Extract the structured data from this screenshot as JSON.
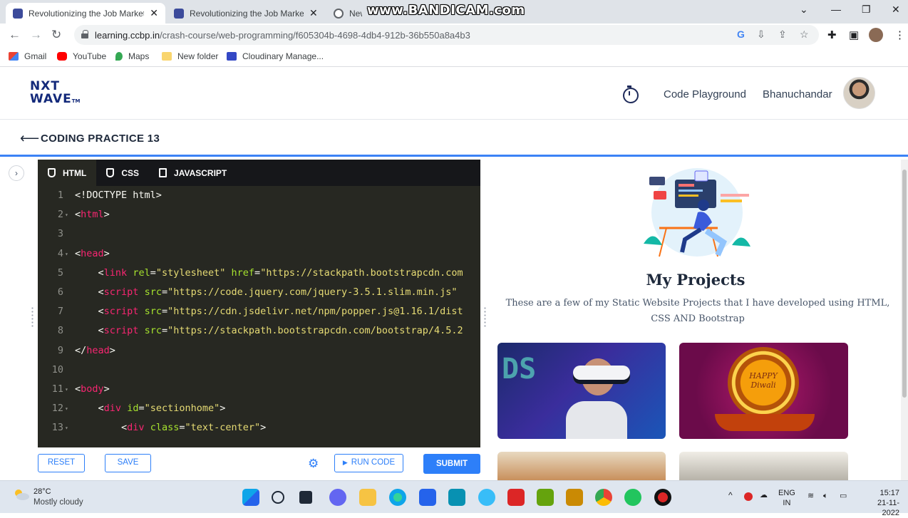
{
  "browser": {
    "tabs": [
      {
        "title": "Revolutionizing the Job Market |",
        "active": true
      },
      {
        "title": "Revolutionizing the Job Market |",
        "active": false
      },
      {
        "title": "New Tab",
        "active": false
      }
    ],
    "watermark": "www.BANDICAM.com",
    "url_host": "learning.ccbp.in",
    "url_path": "/crash-course/web-programming/f605304b-4698-4db4-912b-36b550a8a4b3",
    "bookmarks": [
      "Gmail",
      "YouTube",
      "Maps",
      "New folder",
      "Cloudinary Manage..."
    ]
  },
  "header": {
    "logo_line1": "NXT",
    "logo_line2": "WAVE",
    "logo_tm": "TM",
    "code_playground": "Code Playground",
    "username": "Bhanuchandar"
  },
  "practice": {
    "title": "CODING PRACTICE 13"
  },
  "editor": {
    "tabs": [
      "HTML",
      "CSS",
      "JAVASCRIPT"
    ],
    "active_tab": "HTML",
    "lines": [
      {
        "n": "1",
        "fold": "",
        "indent": "",
        "parts": [
          [
            "t",
            "<!DOCTYPE html>"
          ]
        ]
      },
      {
        "n": "2",
        "fold": "▾",
        "indent": "",
        "parts": [
          [
            "t",
            "<"
          ],
          [
            "g",
            "html"
          ],
          [
            "t",
            ">"
          ]
        ]
      },
      {
        "n": "3",
        "fold": "",
        "indent": "",
        "parts": []
      },
      {
        "n": "4",
        "fold": "▾",
        "indent": "",
        "parts": [
          [
            "t",
            "<"
          ],
          [
            "g",
            "head"
          ],
          [
            "t",
            ">"
          ]
        ]
      },
      {
        "n": "5",
        "fold": "",
        "indent": "    ",
        "parts": [
          [
            "t",
            "<"
          ],
          [
            "g",
            "link"
          ],
          [
            "t",
            " "
          ],
          [
            "a",
            "rel"
          ],
          [
            "t",
            "="
          ],
          [
            "s",
            "\"stylesheet\""
          ],
          [
            "t",
            " "
          ],
          [
            "a",
            "href"
          ],
          [
            "t",
            "="
          ],
          [
            "s",
            "\"https://stackpath.bootstrapcdn.com"
          ]
        ]
      },
      {
        "n": "6",
        "fold": "",
        "indent": "    ",
        "parts": [
          [
            "t",
            "<"
          ],
          [
            "g",
            "script"
          ],
          [
            "t",
            " "
          ],
          [
            "a",
            "src"
          ],
          [
            "t",
            "="
          ],
          [
            "s",
            "\"https://code.jquery.com/jquery-3.5.1.slim.min.js\""
          ]
        ]
      },
      {
        "n": "7",
        "fold": "",
        "indent": "    ",
        "parts": [
          [
            "t",
            "<"
          ],
          [
            "g",
            "script"
          ],
          [
            "t",
            " "
          ],
          [
            "a",
            "src"
          ],
          [
            "t",
            "="
          ],
          [
            "s",
            "\"https://cdn.jsdelivr.net/npm/popper.js@1.16.1/dist"
          ]
        ]
      },
      {
        "n": "8",
        "fold": "",
        "indent": "    ",
        "parts": [
          [
            "t",
            "<"
          ],
          [
            "g",
            "script"
          ],
          [
            "t",
            " "
          ],
          [
            "a",
            "src"
          ],
          [
            "t",
            "="
          ],
          [
            "s",
            "\"https://stackpath.bootstrapcdn.com/bootstrap/4.5.2"
          ]
        ]
      },
      {
        "n": "9",
        "fold": "",
        "indent": "",
        "parts": [
          [
            "t",
            "</"
          ],
          [
            "g",
            "head"
          ],
          [
            "t",
            ">"
          ]
        ]
      },
      {
        "n": "10",
        "fold": "",
        "indent": "",
        "parts": []
      },
      {
        "n": "11",
        "fold": "▾",
        "indent": "",
        "parts": [
          [
            "t",
            "<"
          ],
          [
            "g",
            "body"
          ],
          [
            "t",
            ">"
          ]
        ]
      },
      {
        "n": "12",
        "fold": "▾",
        "indent": "    ",
        "parts": [
          [
            "t",
            "<"
          ],
          [
            "g",
            "div"
          ],
          [
            "t",
            " "
          ],
          [
            "a",
            "id"
          ],
          [
            "t",
            "="
          ],
          [
            "s",
            "\"sectionhome\""
          ],
          [
            "t",
            ">"
          ]
        ]
      },
      {
        "n": "13",
        "fold": "▾",
        "indent": "        ",
        "parts": [
          [
            "t",
            "<"
          ],
          [
            "g",
            "div"
          ],
          [
            "t",
            " "
          ],
          [
            "a",
            "class"
          ],
          [
            "t",
            "="
          ],
          [
            "s",
            "\"text-center\""
          ],
          [
            "t",
            ">"
          ]
        ]
      }
    ]
  },
  "actions": {
    "reset": "RESET",
    "save": "SAVE",
    "run": "RUN CODE",
    "submit": "SUBMIT"
  },
  "preview": {
    "title": "My Projects",
    "description": "These are a few of my Static Website Projects that I have developed using HTML, CSS AND Bootstrap",
    "vr_card_text": "DS",
    "diwali_card_text": "HAPPY Diwali"
  },
  "taskbar": {
    "temperature": "28°C",
    "weather": "Mostly cloudy",
    "lang1": "ENG",
    "lang2": "IN",
    "time": "15:17",
    "date": "21-11-2022"
  },
  "colors": {
    "accent": "#2d7ff9",
    "editor_bg": "#272822",
    "tag": "#f92672",
    "attr": "#a6e22e",
    "string": "#e6db74"
  }
}
